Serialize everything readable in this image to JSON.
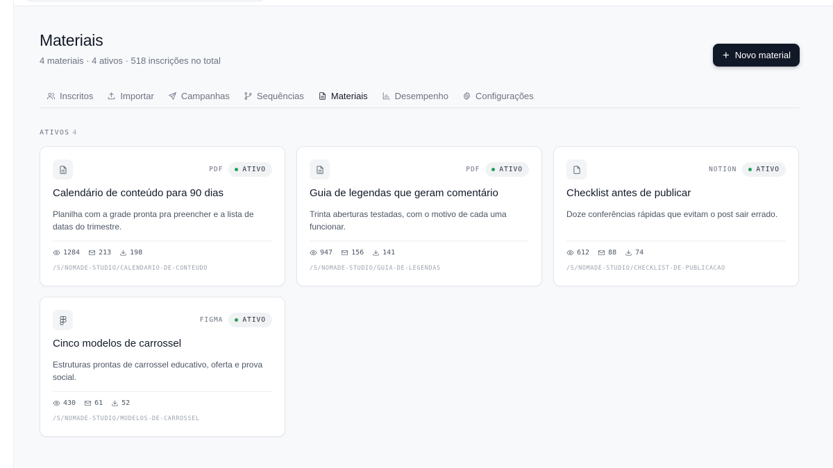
{
  "header": {
    "title": "Materiais",
    "subtitle": "4 materiais · 4 ativos · 518 inscrições no total",
    "new_button_label": "Novo material"
  },
  "tabs": [
    {
      "label": "Inscritos",
      "icon": "users-icon"
    },
    {
      "label": "Importar",
      "icon": "upload-icon"
    },
    {
      "label": "Campanhas",
      "icon": "send-icon"
    },
    {
      "label": "Sequências",
      "icon": "git-branch-icon"
    },
    {
      "label": "Materiais",
      "icon": "file-text-icon",
      "active": true
    },
    {
      "label": "Desempenho",
      "icon": "bar-chart-icon"
    },
    {
      "label": "Configurações",
      "icon": "gear-icon"
    }
  ],
  "section": {
    "label": "ATIVOS",
    "count": "4"
  },
  "cards": [
    {
      "icon": "file-text-icon",
      "type": "PDF",
      "status": "ATIVO",
      "title": "Calendário de conteúdo para 90 dias",
      "description": "Planilha com a grade pronta pra preencher e a lista de datas do trimestre.",
      "views": "1284",
      "subscriptions": "213",
      "downloads": "198",
      "slug": "/S/NOMADE-STUDIO/CALENDARIO-DE-CONTEUDO"
    },
    {
      "icon": "file-text-icon",
      "type": "PDF",
      "status": "ATIVO",
      "title": "Guia de legendas que geram comentário",
      "description": "Trinta aberturas testadas, com o motivo de cada uma funcionar.",
      "views": "947",
      "subscriptions": "156",
      "downloads": "141",
      "slug": "/S/NOMADE-STUDIO/GUIA-DE-LEGENDAS"
    },
    {
      "icon": "file-icon",
      "type": "NOTION",
      "status": "ATIVO",
      "title": "Checklist antes de publicar",
      "description": "Doze conferências rápidas que evitam o post sair errado.",
      "views": "612",
      "subscriptions": "88",
      "downloads": "74",
      "slug": "/S/NOMADE-STUDIO/CHECKLIST-DE-PUBLICACAO"
    },
    {
      "icon": "figma-icon",
      "type": "FIGMA",
      "status": "ATIVO",
      "title": "Cinco modelos de carrossel",
      "description": "Estruturas prontas de carrossel educativo, oferta e prova social.",
      "views": "430",
      "subscriptions": "61",
      "downloads": "52",
      "slug": "/S/NOMADE-STUDIO/MODELOS-DE-CARROSSEL"
    }
  ],
  "colors": {
    "accent": "#111827",
    "status_active": "#22a05a"
  }
}
